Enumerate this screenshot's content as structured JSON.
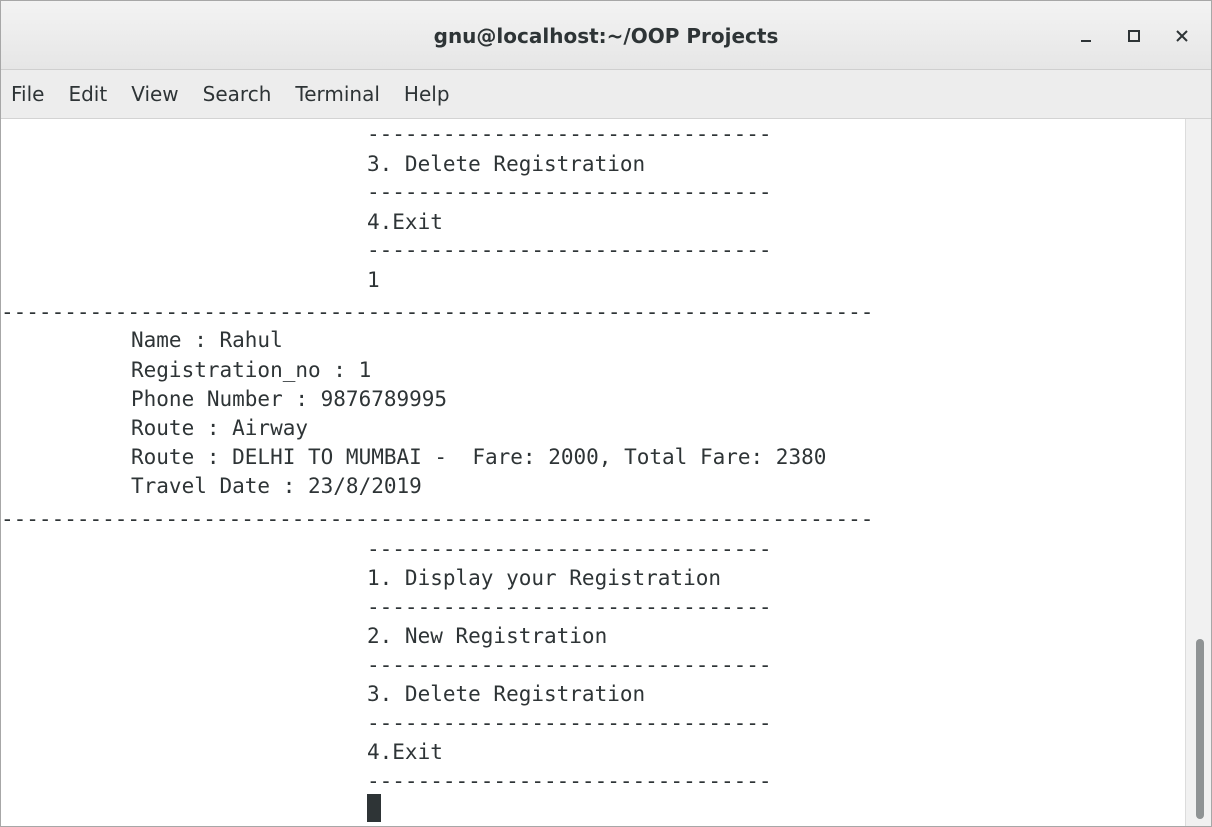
{
  "window": {
    "title": "gnu@localhost:~/OOP Projects",
    "buttons": [
      {
        "name": "minimize-icon"
      },
      {
        "name": "maximize-icon"
      },
      {
        "name": "close-icon"
      }
    ]
  },
  "menu": {
    "items": [
      "File",
      "Edit",
      "View",
      "Search",
      "Terminal",
      "Help"
    ]
  },
  "terminal": {
    "lines": [
      "--------------------------------",
      "3. Delete Registration",
      "--------------------------------",
      "4.Exit",
      "--------------------------------",
      "1",
      "---------------------------------------------------------------------",
      "Name : Rahul",
      "Registration_no : 1",
      "Phone Number : 9876789995",
      "Route : Airway",
      "Route : DELHI TO MUMBAI -  Fare: 2000, Total Fare: 2380",
      "Travel Date : 23/8/2019",
      "---------------------------------------------------------------------",
      "--------------------------------",
      "1. Display your Registration",
      "--------------------------------",
      "2. New Registration",
      "--------------------------------",
      "3. Delete Registration",
      "--------------------------------",
      "4.Exit",
      "--------------------------------"
    ]
  },
  "colors": {
    "text": "#2e3436",
    "background": "#ffffff",
    "chrome": "#ededed"
  }
}
